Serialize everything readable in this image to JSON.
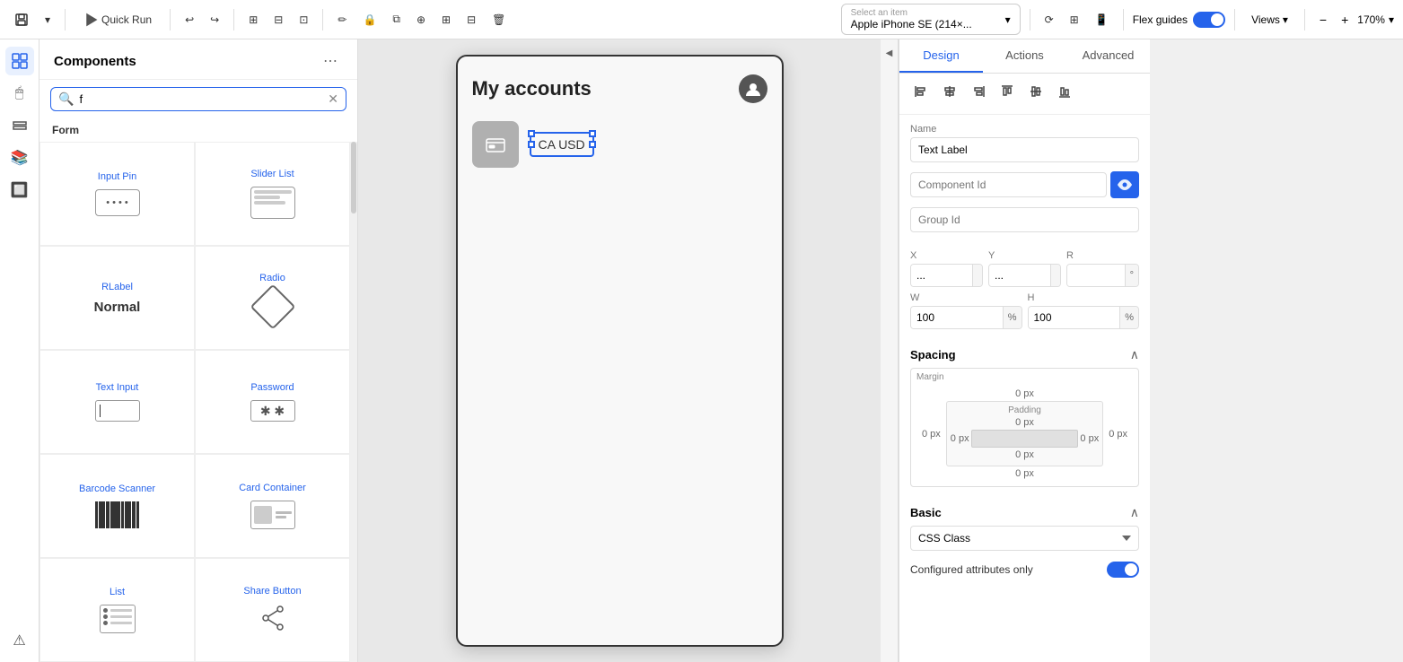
{
  "toolbar": {
    "quick_run_label": "Quick Run",
    "device_label": "Apple iPhone SE (214×...",
    "device_placeholder": "Select an item",
    "flex_guides_label": "Flex guides",
    "views_label": "Views",
    "zoom_level": "170%",
    "zoom_minus": "−",
    "zoom_plus": "+"
  },
  "components_panel": {
    "title": "Components",
    "search_placeholder": "f",
    "section_label": "Form",
    "items": [
      {
        "name": "Input Pin",
        "icon": "🔢"
      },
      {
        "name": "Slider List",
        "icon": "☰"
      },
      {
        "name": "RLabel",
        "icon": "N"
      },
      {
        "name": "Radio",
        "icon": "◇"
      },
      {
        "name": "Text Input",
        "icon": "□"
      },
      {
        "name": "Password",
        "icon": "**"
      },
      {
        "name": "Barcode Scanner",
        "icon": "▤"
      },
      {
        "name": "Card Container",
        "icon": "🪪"
      },
      {
        "name": "List",
        "icon": "☰"
      },
      {
        "name": "Share Button",
        "icon": "⬆"
      }
    ]
  },
  "canvas": {
    "phone_title": "My accounts",
    "account_label": "CA USD"
  },
  "right_panel": {
    "tabs": [
      "Design",
      "Actions",
      "Advanced"
    ],
    "active_tab": "Design",
    "name_label": "Name",
    "name_value": "Text Label",
    "component_id_label": "Component Id",
    "component_id_placeholder": "Component Id",
    "group_id_label": "Group Id",
    "group_id_placeholder": "Group Id",
    "x_label": "X",
    "x_value": "...",
    "y_label": "Y",
    "y_value": "...",
    "r_label": "R",
    "r_unit": "°",
    "w_label": "W",
    "w_value": "100",
    "w_unit": "%",
    "h_label": "H",
    "h_value": "100",
    "h_unit": "%",
    "spacing_title": "Spacing",
    "margin_label": "Margin",
    "padding_label": "Padding",
    "margin_top": "0  px",
    "margin_left": "0  px",
    "margin_right": "0  px",
    "margin_bottom": "0  px",
    "padding_top": "0  px",
    "padding_left": "0  px",
    "padding_right": "0  px",
    "padding_bottom": "0  px",
    "basic_title": "Basic",
    "css_class_label": "CSS Class",
    "css_class_placeholder": "CSS Class",
    "configured_only_label": "Configured attributes only"
  },
  "sidebar_icons": [
    "⊞",
    "🖱",
    "⬛",
    "📚",
    "🔲",
    "⚠"
  ]
}
